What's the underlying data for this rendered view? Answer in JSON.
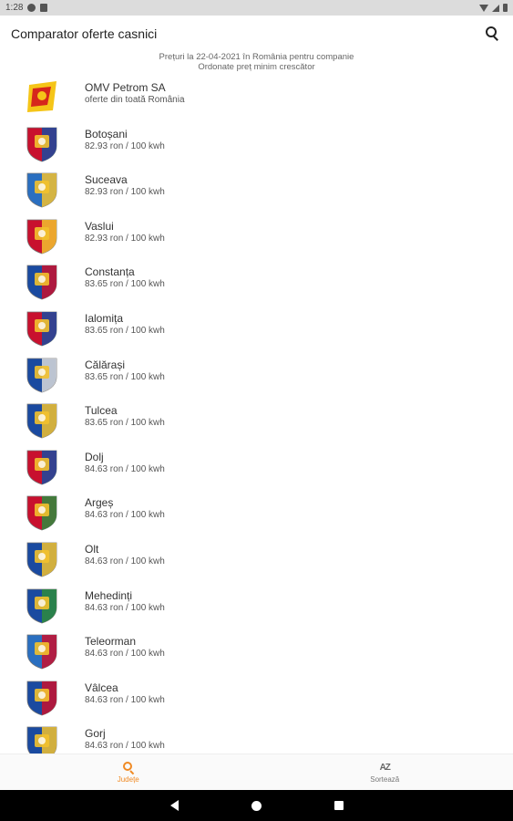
{
  "status_bar": {
    "time": "1:28"
  },
  "app_bar": {
    "title": "Comparator oferte casnici"
  },
  "subtitle": {
    "line1": "Prețuri la 22-04-2021 în România pentru companie",
    "line2": "Ordonate preț minim crescător"
  },
  "items": [
    {
      "name": "OMV Petrom SA",
      "price": "oferte din toată România",
      "icon": "omv-petrom-logo-icon",
      "colors": [
        "#f5c518",
        "#d6261c"
      ]
    },
    {
      "name": "Botoșani",
      "price": "82.93 ron / 100 kwh",
      "icon": "botosani-crest-icon",
      "colors": [
        "#c8102e",
        "#1a4aa0"
      ]
    },
    {
      "name": "Suceava",
      "price": "82.93 ron / 100 kwh",
      "icon": "suceava-crest-icon",
      "colors": [
        "#2a6fc0",
        "#f2c12e"
      ]
    },
    {
      "name": "Vaslui",
      "price": "82.93 ron / 100 kwh",
      "icon": "vaslui-crest-icon",
      "colors": [
        "#c8102e",
        "#f2c12e"
      ]
    },
    {
      "name": "Constanța",
      "price": "83.65 ron / 100 kwh",
      "icon": "constanta-crest-icon",
      "colors": [
        "#1a4aa0",
        "#c8102e"
      ]
    },
    {
      "name": "Ialomița",
      "price": "83.65 ron / 100 kwh",
      "icon": "ialomita-crest-icon",
      "colors": [
        "#c8102e",
        "#1a4aa0"
      ]
    },
    {
      "name": "Călărași",
      "price": "83.65 ron / 100 kwh",
      "icon": "calarasi-crest-icon",
      "colors": [
        "#1a4aa0",
        "#d9d9d9"
      ]
    },
    {
      "name": "Tulcea",
      "price": "83.65 ron / 100 kwh",
      "icon": "tulcea-crest-icon",
      "colors": [
        "#1a4aa0",
        "#f2c12e"
      ]
    },
    {
      "name": "Dolj",
      "price": "84.63 ron / 100 kwh",
      "icon": "dolj-crest-icon",
      "colors": [
        "#c8102e",
        "#1a4aa0"
      ]
    },
    {
      "name": "Argeș",
      "price": "84.63 ron / 100 kwh",
      "icon": "arges-crest-icon",
      "colors": [
        "#c8102e",
        "#2e8b3d"
      ]
    },
    {
      "name": "Olt",
      "price": "84.63 ron / 100 kwh",
      "icon": "olt-crest-icon",
      "colors": [
        "#1a4aa0",
        "#f2c12e"
      ]
    },
    {
      "name": "Mehedinți",
      "price": "84.63 ron / 100 kwh",
      "icon": "mehedinti-crest-icon",
      "colors": [
        "#1a4aa0",
        "#2e8b3d"
      ]
    },
    {
      "name": "Teleorman",
      "price": "84.63 ron / 100 kwh",
      "icon": "teleorman-crest-icon",
      "colors": [
        "#2a6fc0",
        "#c8102e"
      ]
    },
    {
      "name": "Vâlcea",
      "price": "84.63 ron / 100 kwh",
      "icon": "valcea-crest-icon",
      "colors": [
        "#1a4aa0",
        "#c8102e"
      ]
    },
    {
      "name": "Gorj",
      "price": "84.63 ron / 100 kwh",
      "icon": "gorj-crest-icon",
      "colors": [
        "#1a4aa0",
        "#f2c12e"
      ]
    }
  ],
  "bottom_nav": {
    "tab1": {
      "label": "Județe",
      "icon": "search-icon"
    },
    "tab2": {
      "label": "Sortează",
      "icon": "sort-az-icon",
      "glyph": "AZ"
    }
  },
  "colors": {
    "accent": "#f08a24"
  }
}
